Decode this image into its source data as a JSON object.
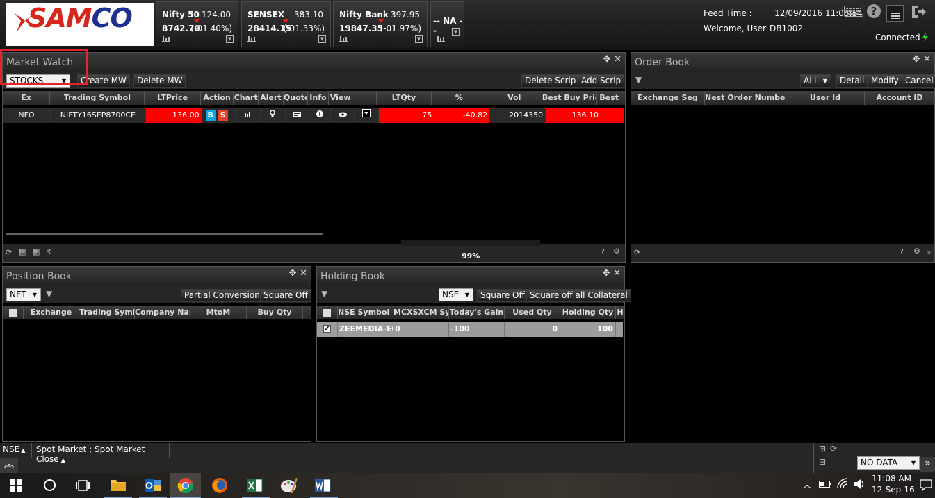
{
  "header": {
    "logo_text": "SAMCO",
    "indices": [
      {
        "name": "Nifty 50",
        "change": "-124.00",
        "value": "8742.70",
        "pct": "(-01.40%)"
      },
      {
        "name": "SENSEX",
        "change": "-383.10",
        "value": "28414.15",
        "pct": "(-01.33%)"
      },
      {
        "name": "Nifty Bank",
        "change": "-397.95",
        "value": "19847.35",
        "pct": "(-01.97%)"
      },
      {
        "name": "-- NA --",
        "change": "",
        "value": "",
        "pct": ""
      }
    ],
    "feed_time_label": "Feed Time :",
    "feed_time": "12/09/2016 11:08:54",
    "welcome": "Welcome, User",
    "user_id": "DB1002",
    "connection": "Connected"
  },
  "market_watch": {
    "title": "Market Watch",
    "watchlist": "STOCKS",
    "create_label": "Create MW",
    "delete_label": "Delete MW",
    "delete_scrip": "Delete Scrip",
    "add_scrip": "Add Scrip",
    "columns": [
      "Ex",
      "Trading Symbol",
      "LTPrice",
      "Action",
      "Chart",
      "Alert",
      "Quote",
      "Info",
      "View",
      "",
      "LTQty",
      "%",
      "Vol",
      "Best Buy Pric",
      "Best"
    ],
    "row": {
      "ex": "NFO",
      "symbol": "NIFTY16SEP8700CE",
      "ltp": "136.00",
      "buy": "B",
      "sell": "S",
      "ltqty": "75",
      "pct": "-40.82",
      "vol": "2014350",
      "bestbuy": "136.10"
    },
    "progress": "99%"
  },
  "order_book": {
    "title": "Order Book",
    "filter": "ALL",
    "buttons": [
      "Detail",
      "Modify",
      "Cancel"
    ],
    "columns": [
      "Exchange Seg",
      "Nest Order Number",
      "User Id",
      "Account ID"
    ]
  },
  "position_book": {
    "title": "Position Book",
    "filter": "NET",
    "partial": "Partial Conversion",
    "square_off": "Square Off",
    "columns": [
      "Exchange",
      "Trading Symb",
      "Company Nar",
      "MtoM",
      "Buy Qty"
    ]
  },
  "holding_book": {
    "title": "Holding Book",
    "exchange": "NSE",
    "square_off": "Square Off",
    "square_off_all": "Square off all Collateral",
    "columns": [
      "NSE Symbol I",
      "MCXSXCM Sy",
      "Today's Gain",
      "Used Qty",
      "Holding Qty",
      "H"
    ],
    "row": {
      "symbol": "ZEEMEDIA-EQ",
      "mcx": "0",
      "gain": "-100",
      "used": "0",
      "holding": "100"
    }
  },
  "status_bar": {
    "exchange": "NSE",
    "market": "Spot Market ; Spot Market Close",
    "data_select": "NO DATA"
  },
  "taskbar": {
    "time": "11:08 AM",
    "date": "12-Sep-16"
  }
}
